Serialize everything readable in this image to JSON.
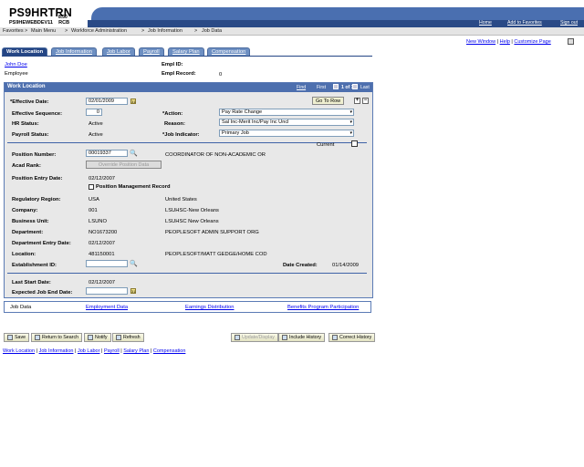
{
  "header": {
    "title": "PS9HRTRN",
    "version": "8.50",
    "db": "PS9HEWEBDEV11",
    "server": "RCB",
    "links": [
      "Home",
      "Add to Favorites",
      "Sign out"
    ]
  },
  "menu": {
    "items": [
      "Favorites",
      "Main Menu",
      "Workforce Administration",
      "Job Information",
      "Job Data"
    ],
    "sep": ">"
  },
  "toplinks": {
    "new_window": "New Window",
    "help": "Help",
    "customize": "Customize Page"
  },
  "tabs": [
    "Work Location",
    "Job Information",
    "Job Labor",
    "Payroll",
    "Salary Plan",
    "Compensation"
  ],
  "employee": {
    "name": "John Doe",
    "type": "Employee",
    "empl_id_label": "Empl ID:",
    "empl_record_label": "Empl Record:",
    "empl_record": "0"
  },
  "panel": {
    "title": "Work Location",
    "find": "Find",
    "nav": "First",
    "count": "1 of 1",
    "last": "Last",
    "goto": "Go To Row"
  },
  "fields": {
    "effective_date_label": "*Effective Date:",
    "effective_date": "02/01/2009",
    "effective_seq_label": "Effective Sequence:",
    "effective_seq": "0",
    "hr_status_label": "HR Status:",
    "hr_status": "Active",
    "payroll_status_label": "Payroll Status:",
    "payroll_status": "Active",
    "action_label": "*Action:",
    "action": "Pay Rate Change",
    "reason_label": "Reason:",
    "reason": "Sal Inc-Merit Inc/Pay Inc Uncl",
    "job_indicator_label": "*Job Indicator:",
    "job_indicator": "Primary Job",
    "current_label": "Current",
    "position_number_label": "Position Number:",
    "position_number": "00019337",
    "position_desc": "COORDINATOR OF NON-ACADEMIC OR",
    "acad_rank_label": "Acad Rank:",
    "override_btn": "Override Position Data",
    "position_entry_label": "Position Entry Date:",
    "position_entry": "02/12/2007",
    "pos_mgmt_label": "Position Management Record",
    "regulatory_label": "Regulatory Region:",
    "regulatory": "USA",
    "regulatory_desc": "United States",
    "company_label": "Company:",
    "company": "001",
    "company_desc": "LSUHSC-New Orleans",
    "business_unit_label": "Business Unit:",
    "business_unit": "LSUNO",
    "business_unit_desc": "LSUHSC New Orleans",
    "department_label": "Department:",
    "department": "NO1673200",
    "department_desc": "PEOPLESOFT ADMIN SUPPORT ORG",
    "dept_entry_label": "Department Entry Date:",
    "dept_entry": "02/12/2007",
    "location_label": "Location:",
    "location": "481150001",
    "location_desc": "PEOPLESOFT/MATT GEDGE/HOME COD",
    "establishment_label": "Establishment ID:",
    "date_created_label": "Date Created:",
    "date_created": "01/14/2009",
    "last_start_label": "Last Start Date:",
    "last_start": "02/12/2007",
    "expected_end_label": "Expected Job End Date:"
  },
  "bottom_tabs": {
    "label": "Job Data",
    "links": [
      "Employment Data",
      "Earnings Distribution",
      "Benefits Program Participation"
    ]
  },
  "toolbar": {
    "save": "Save",
    "return": "Return to Search",
    "notify": "Notify",
    "refresh": "Refresh",
    "update": "Update/Display",
    "include": "Include History",
    "correct": "Correct History"
  },
  "footer": {
    "links": [
      "Work Location",
      "Job Information",
      "Job Labor",
      "Payroll",
      "Salary Plan",
      "Compensation"
    ]
  }
}
